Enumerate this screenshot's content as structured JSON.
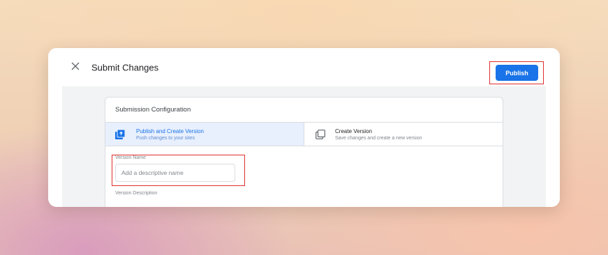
{
  "dialog": {
    "title": "Submit Changes",
    "publish_label": "Publish"
  },
  "config": {
    "title": "Submission Configuration",
    "options": [
      {
        "title": "Publish and Create Version",
        "subtitle": "Push changes to your sites",
        "selected": true,
        "icon": "publish-upload-icon"
      },
      {
        "title": "Create Version",
        "subtitle": "Save changes and create a new version",
        "selected": false,
        "icon": "copy-version-icon"
      }
    ],
    "version_name": {
      "label": "Version Name",
      "placeholder": "Add a descriptive name",
      "value": ""
    },
    "version_description": {
      "label": "Version Description"
    }
  },
  "colors": {
    "accent": "#1a73e8",
    "highlight": "#e02d2d",
    "selected_bg": "#e8f0fe"
  }
}
